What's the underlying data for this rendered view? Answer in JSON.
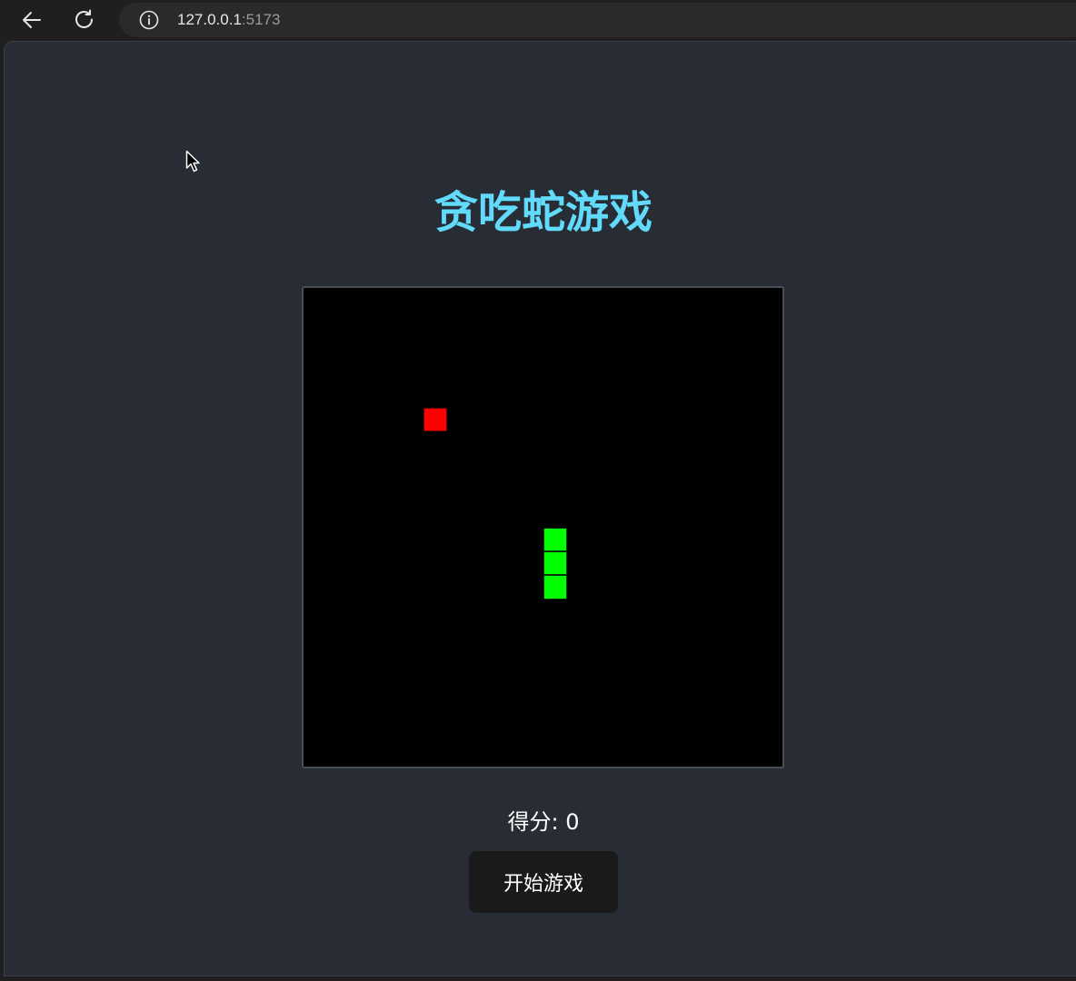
{
  "browser": {
    "url_host": "127.0.0.1",
    "url_port": ":5173",
    "icons": [
      "back-arrow-icon",
      "reload-icon",
      "info-icon"
    ]
  },
  "game": {
    "title": "贪吃蛇游戏",
    "title_color": "#61dafb",
    "score_label": "得分: 0",
    "score": 0,
    "start_button_label": "开始游戏",
    "board_color": "#000000",
    "grid": {
      "columns": 20,
      "rows": 20
    },
    "food": {
      "col": 5,
      "row": 5,
      "color": "#ff0000"
    },
    "snake": {
      "color": "#00ff00",
      "segments": [
        {
          "col": 10,
          "row": 10
        },
        {
          "col": 10,
          "row": 11
        },
        {
          "col": 10,
          "row": 12
        }
      ]
    }
  }
}
